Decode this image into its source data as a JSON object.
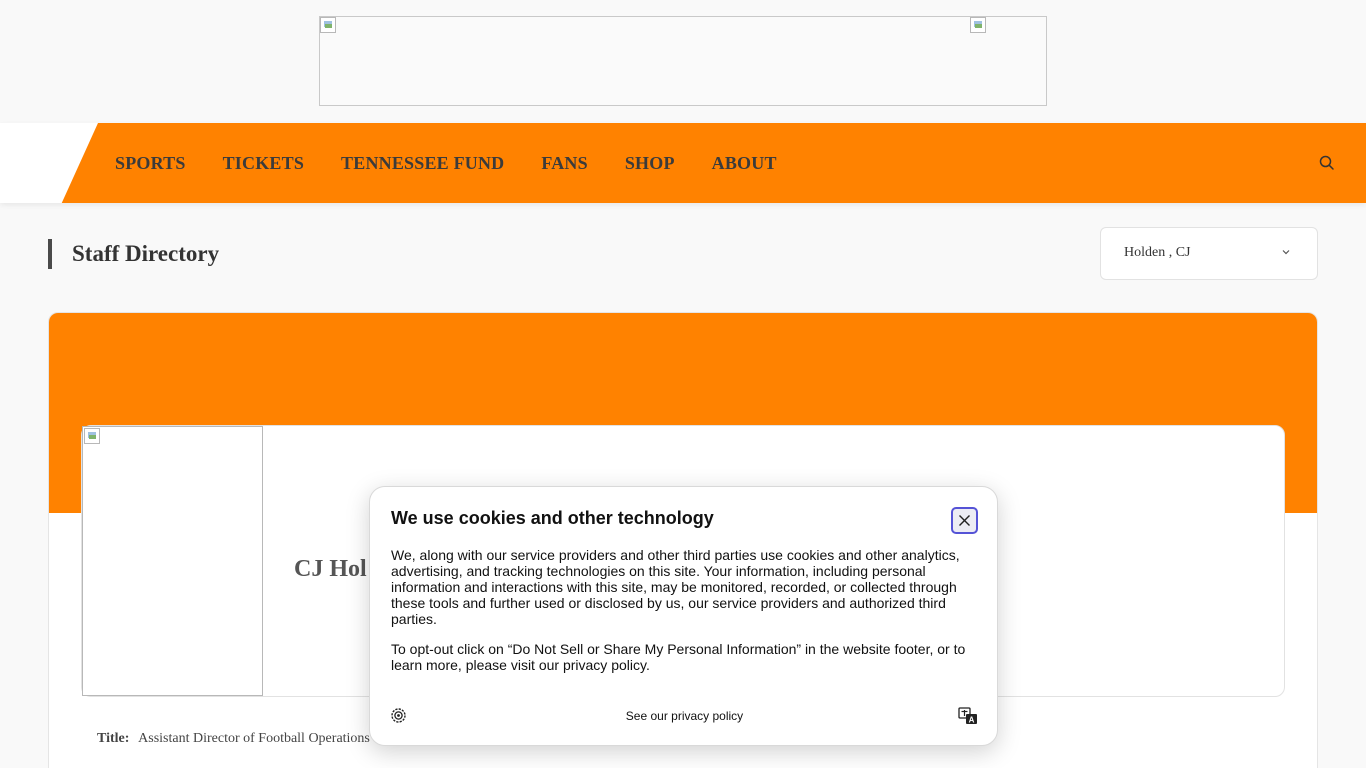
{
  "nav": {
    "items": [
      {
        "label": "SPORTS"
      },
      {
        "label": "TICKETS"
      },
      {
        "label": "TENNESSEE FUND"
      },
      {
        "label": "FANS"
      },
      {
        "label": "SHOP"
      },
      {
        "label": "ABOUT"
      }
    ],
    "search_icon": "search-icon"
  },
  "page": {
    "title": "Staff Directory",
    "staff_select": {
      "selected": "Holden , CJ",
      "icon": "chevron-down-icon"
    }
  },
  "profile": {
    "name": "CJ Hol",
    "title_label": "Title:",
    "title_value": "Assistant Director of Football Operations"
  },
  "cookie_dialog": {
    "title": "We use cookies and other technology",
    "paragraph1": "We, along with our service providers and other third parties use cookies and other analytics, advertising, and tracking technologies on this site. Your information, including personal information and interactions with this site, may be monitored, recorded, or collected through these tools and further used or disclosed by us, our service providers and authorized third parties.",
    "paragraph2": "To opt-out click on “Do Not Sell or Share My Personal Information” in the website footer, or to learn more, please visit our privacy policy.",
    "privacy_link": "See our privacy policy",
    "close_icon": "close-icon",
    "settings_icon": "gear-icon",
    "language_icon": "translate-icon"
  },
  "colors": {
    "brand_orange": "#ff8200",
    "focus_ring": "#5553d6"
  }
}
